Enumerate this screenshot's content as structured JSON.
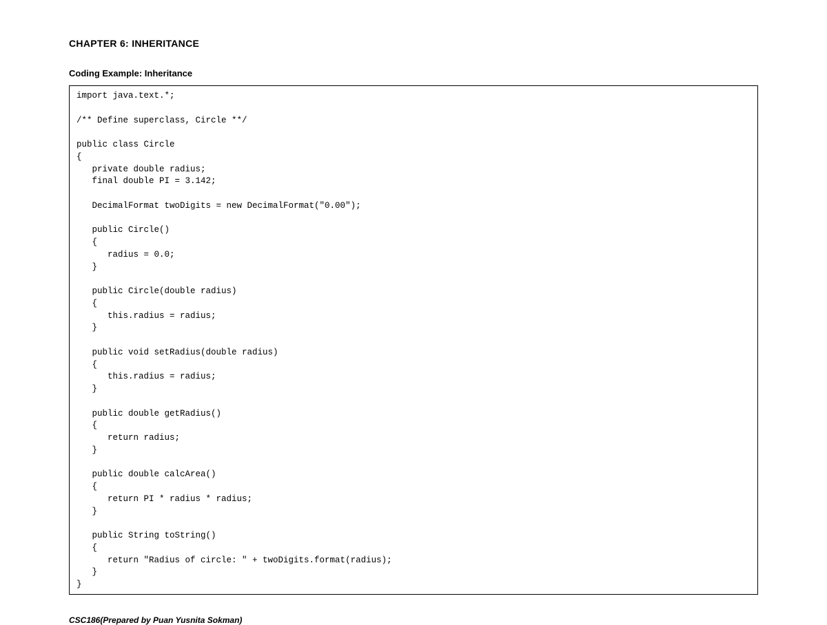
{
  "chapter_heading": "CHAPTER 6: INHERITANCE",
  "subheading": "Coding Example: Inheritance",
  "code": "import java.text.*;\n\n/** Define superclass, Circle **/\n\npublic class Circle\n{\n   private double radius;\n   final double PI = 3.142;\n\n   DecimalFormat twoDigits = new DecimalFormat(\"0.00\");\n\n   public Circle()\n   {\n      radius = 0.0;\n   }\n\n   public Circle(double radius)\n   {\n      this.radius = radius;\n   }\n\n   public void setRadius(double radius)\n   {\n      this.radius = radius;\n   }\n\n   public double getRadius()\n   {\n      return radius;\n   }\n\n   public double calcArea()\n   {\n      return PI * radius * radius;\n   }\n\n   public String toString()\n   {\n      return \"Radius of circle: \" + twoDigits.format(radius);\n   }\n}",
  "footer": "CSC186(Prepared by Puan Yusnita Sokman)"
}
